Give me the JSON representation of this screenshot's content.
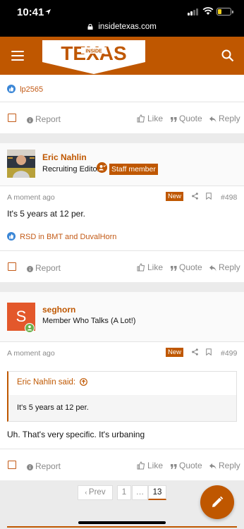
{
  "status_bar": {
    "time": "10:41"
  },
  "browser": {
    "url": "insidetexas.com"
  },
  "header": {
    "logo_main": "TEXAS",
    "logo_sub": "INSIDE"
  },
  "prev_post": {
    "reactions": "lp2565"
  },
  "actions": {
    "report": "Report",
    "like": "Like",
    "quote": "Quote",
    "reply": "Reply"
  },
  "posts": [
    {
      "author": "Eric Nahlin",
      "role": "Recruiting Editor",
      "badge": "Staff member",
      "time": "A moment ago",
      "new_label": "New",
      "number": "#498",
      "text": "It's 5 years at 12 per.",
      "reactions": "RSD in BMT and DuvalHorn"
    },
    {
      "author": "seghorn",
      "avatar_letter": "S",
      "role": "Member Who Talks (A Lot!)",
      "time": "A moment ago",
      "new_label": "New",
      "number": "#499",
      "quote_author": "Eric Nahlin said:",
      "quote_text": "It's 5 years at 12 per.",
      "text": "Uh. That's very specific. It's urbaning"
    }
  ],
  "pagination": {
    "prev": "Prev",
    "first": "1",
    "ellipsis": "…",
    "current": "13"
  },
  "colors": {
    "accent": "#bf5700",
    "reaction_blue": "#3a86d6",
    "online": "#6ab04c"
  }
}
